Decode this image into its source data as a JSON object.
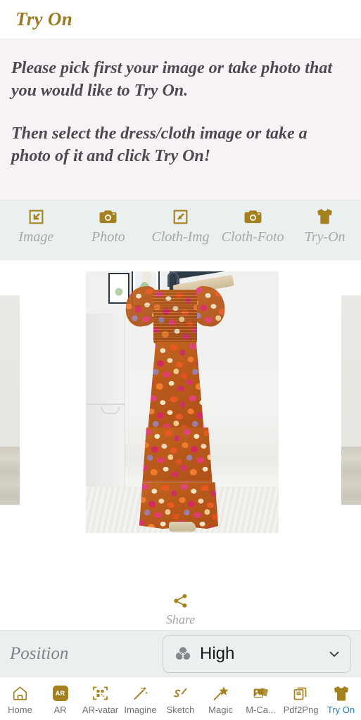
{
  "header": {
    "title": "Try On"
  },
  "instructions": {
    "paragraph1": "Please pick first your image or take photo that you would like to Try On.",
    "paragraph2": "Then select the dress/cloth image or take a photo of it and click Try On!"
  },
  "toolbar": {
    "items": [
      {
        "label": "Image",
        "icon": "image-import-icon"
      },
      {
        "label": "Photo",
        "icon": "camera-icon"
      },
      {
        "label": "Cloth-Img",
        "icon": "image-import-icon"
      },
      {
        "label": "Cloth-Foto",
        "icon": "camera-icon"
      },
      {
        "label": "Try-On",
        "icon": "tshirt-icon"
      }
    ]
  },
  "stage": {
    "photo_alt": "Floral maxi dress on hanger",
    "share_label": "Share",
    "share_icon": "share-icon"
  },
  "position": {
    "label": "Position",
    "selected_value": "High",
    "icon": "venn-circles-icon",
    "chevron": "chevron-down-icon",
    "options": [
      "High"
    ]
  },
  "bottom_nav": {
    "active_index": 8,
    "active_color": "#2a7ab8",
    "icon_color": "#a5801f",
    "items": [
      {
        "label": "Home",
        "icon": "home-icon"
      },
      {
        "label": "AR",
        "icon": "ar-badge-icon"
      },
      {
        "label": "AR-vatar",
        "icon": "qr-code-icon"
      },
      {
        "label": "Imagine",
        "icon": "magic-wand-icon"
      },
      {
        "label": "Sketch",
        "icon": "sketch-pen-icon"
      },
      {
        "label": "Magic",
        "icon": "star-wand-icon"
      },
      {
        "label": "M-Ca...",
        "icon": "photo-stack-icon"
      },
      {
        "label": "Pdf2Png",
        "icon": "pdf-icon"
      },
      {
        "label": "Try On",
        "icon": "tshirt-icon"
      }
    ]
  },
  "colors": {
    "gold": "#a5801f",
    "title_gold": "#9a7b22",
    "instruction_bg": "#f8f2f6",
    "toolbar_bg": "#eaeff0",
    "position_bg": "#eceff0",
    "muted_text": "#a3a8ab",
    "active_blue": "#2a7ab8"
  }
}
